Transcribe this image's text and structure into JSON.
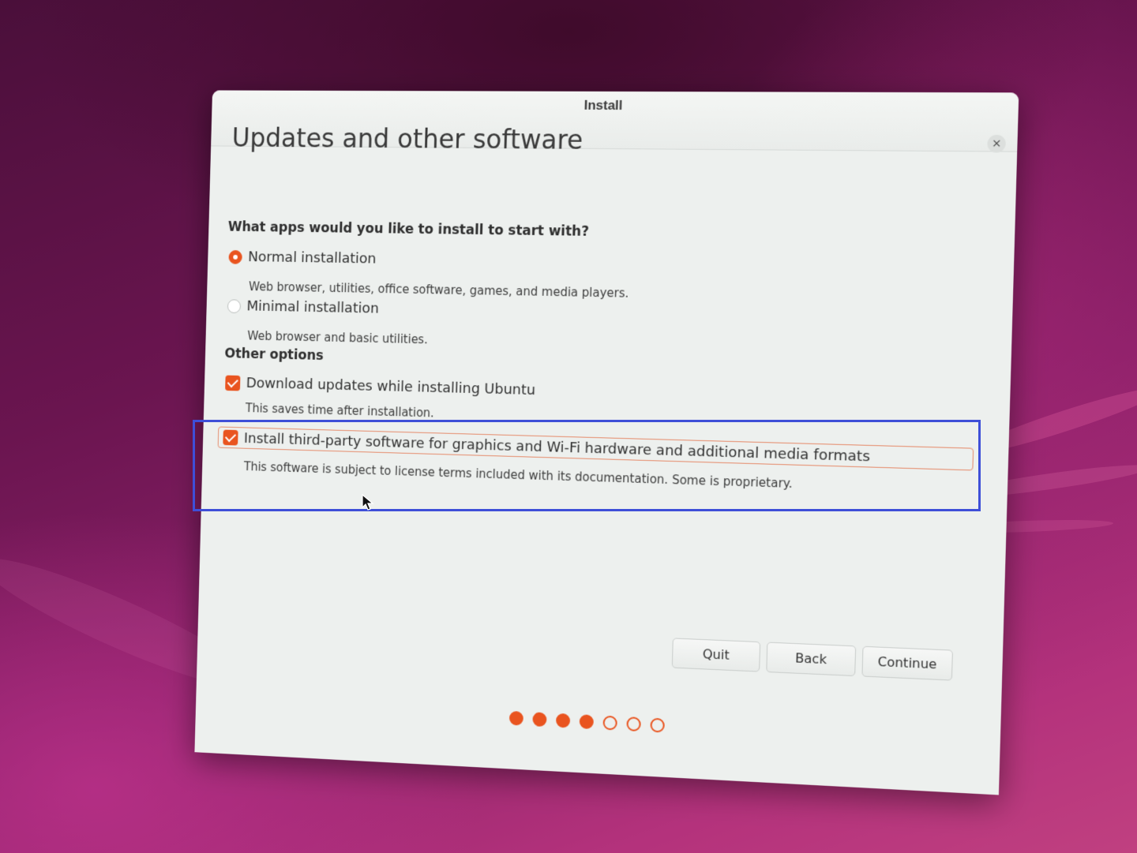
{
  "window": {
    "title": "Install",
    "close_glyph": "×"
  },
  "page": {
    "title": "Updates and other software"
  },
  "apps_section": {
    "heading": "What apps would you like to install to start with?",
    "options": [
      {
        "label": "Normal installation",
        "description": "Web browser, utilities, office software, games, and media players.",
        "selected": true
      },
      {
        "label": "Minimal installation",
        "description": "Web browser and basic utilities.",
        "selected": false
      }
    ]
  },
  "other_section": {
    "heading": "Other options",
    "options": [
      {
        "label": "Download updates while installing Ubuntu",
        "description": "This saves time after installation.",
        "checked": true
      },
      {
        "label": "Install third-party software for graphics and Wi-Fi hardware and additional media formats",
        "description": "This software is subject to license terms included with its documentation. Some is proprietary.",
        "checked": true
      }
    ]
  },
  "buttons": {
    "quit": "Quit",
    "back": "Back",
    "continue": "Continue"
  },
  "progress": {
    "total_steps": 7,
    "completed_steps": 4
  },
  "colors": {
    "accent": "#e9541f",
    "highlight_box": "#3e4fd8"
  },
  "icons": {
    "close": "close-icon",
    "cursor": "mouse-pointer-icon"
  }
}
